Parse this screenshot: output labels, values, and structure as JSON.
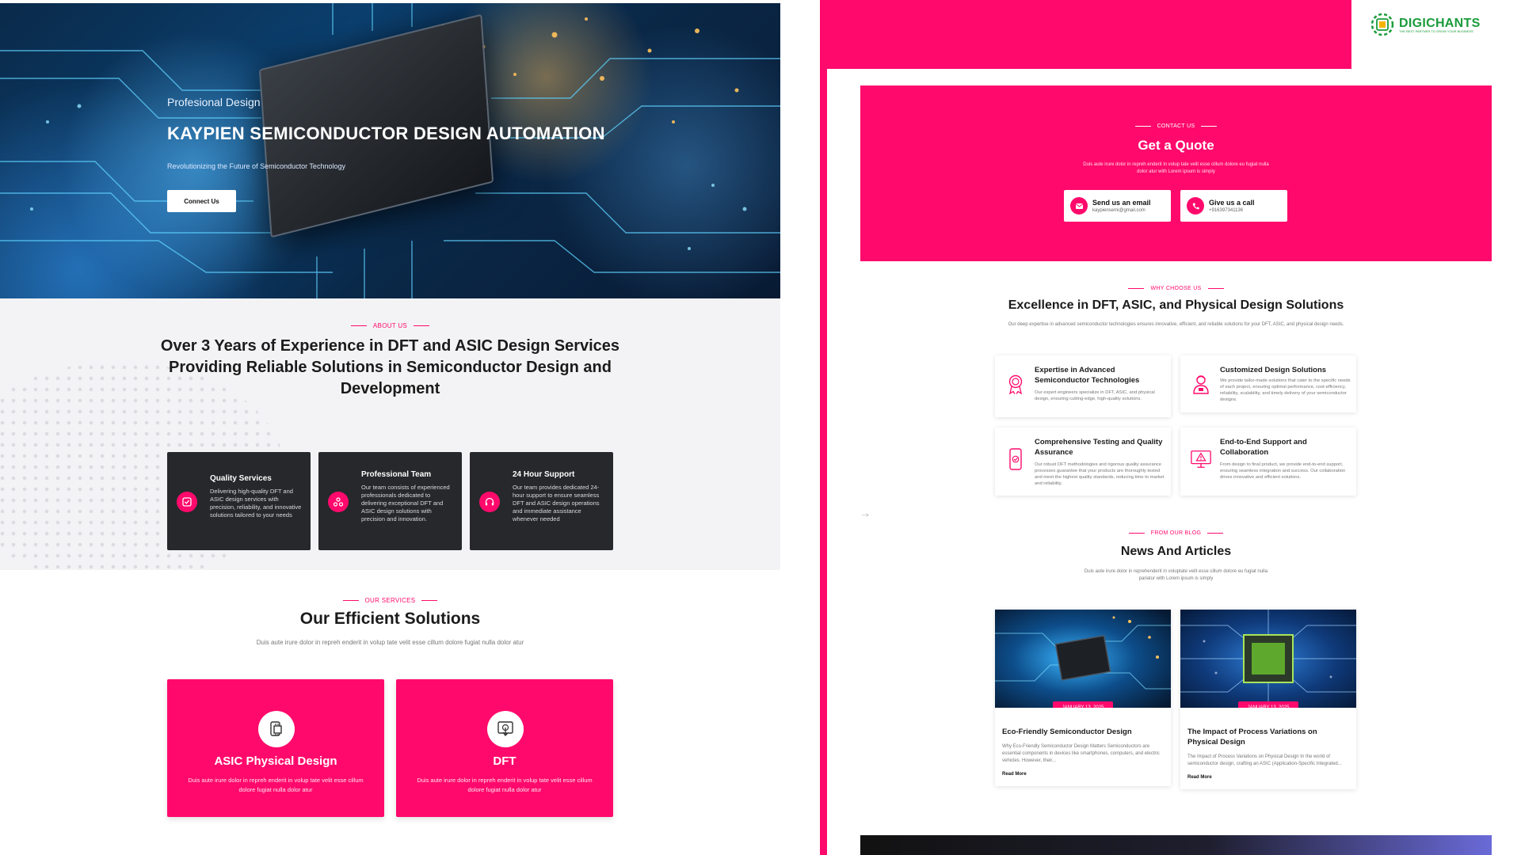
{
  "hero": {
    "pre": "Profesional Design",
    "title": "KAYPIEN SEMICONDUCTOR DESIGN AUTOMATION",
    "subtitle": "Revolutionizing the Future of Semiconductor Technology",
    "button": "Connect Us"
  },
  "about": {
    "tag": "ABOUT US",
    "heading_line1": "Over 3 Years of Experience in DFT and ASIC Design Services",
    "heading_line2": "Providing Reliable Solutions in Semiconductor Design and Development",
    "cards": [
      {
        "title": "Quality Services",
        "text": "Delivering high-quality DFT and ASIC design services with precision, reliability, and innovative solutions tailored to your needs",
        "icon": "quality-icon"
      },
      {
        "title": "Professional Team",
        "text": "Our team consists of experienced professionals dedicated to delivering exceptional DFT and ASIC design solutions with precision and innovation.",
        "icon": "team-icon"
      },
      {
        "title": "24 Hour Support",
        "text": "Our team provides dedicated 24-hour support to ensure seamless DFT and ASIC design operations and immediate assistance whenever needed",
        "icon": "headset-icon"
      }
    ]
  },
  "services": {
    "tag": "OUR SERVICES",
    "heading": "Our Efficient Solutions",
    "subtitle": "Duis aute irure dolor in repreh enderit in volup tate velit esse cillum dolore fugiat nulla dolor atur",
    "cards": [
      {
        "title": "ASIC Physical Design",
        "text": "Duis aute irure dolor in repreh enderit in volup tate velit esse cillum dolore fugiat nulla dolor atur",
        "icon": "chip-design-icon"
      },
      {
        "title": "DFT",
        "text": "Duis aute irure dolor in repreh enderit in volup tate velit esse cillum dolore fugiat nulla dolor atur",
        "icon": "touch-screen-icon"
      }
    ]
  },
  "brand": {
    "name": "DIGICHANTS",
    "tagline": "THE BEST PARTNER TO GROW YOUR BUSINESS",
    "color": "#1a9b3a"
  },
  "quote": {
    "tag": "CONTACT US",
    "heading": "Get a Quote",
    "subtitle": "Duis aute irure dolor in repreh enderit in volup tate velit esse cillum dolore eu fugiat nulla dolor atur with Lorem ipsum is simply",
    "email_label": "Send us an email",
    "email_value": "kaypiensemi@gmail.com",
    "call_label": "Give us a call",
    "call_value": "+916397341136"
  },
  "why": {
    "tag": "WHY CHOOSE US",
    "heading": "Excellence in DFT, ASIC, and Physical Design Solutions",
    "subtitle": "Our deep expertise in advanced semiconductor technologies ensures innovative, efficient, and reliable solutions for your DFT, ASIC, and physical design needs.",
    "features": [
      {
        "title": "Expertise in Advanced Semiconductor Technologies",
        "text": "Our expert engineers specialize in DFT, ASIC, and physical design, ensuring cutting-edge, high-quality solutions.",
        "icon": "award-icon"
      },
      {
        "title": "Customized Design Solutions",
        "text": "We provide tailor-made solutions that cater to the specific needs of each project, ensuring optimal performance, cost-efficiency, reliability, scalability, and timely delivery of your semiconductor designs.",
        "icon": "engineer-icon"
      },
      {
        "title": "Comprehensive Testing and Quality Assurance",
        "text": "Our robust DFT methodologies and rigorous quality assurance processes guarantee that your products are thoroughly tested and meet the highest quality standards, reducing time to market and reliability.",
        "icon": "mobile-check-icon"
      },
      {
        "title": "End-to-End Support and Collaboration",
        "text": "From design to final product, we provide end-to-end support, ensuring seamless integration and success. Our collaboration drives innovative and efficient solutions.",
        "icon": "monitor-alert-icon"
      }
    ]
  },
  "blog": {
    "tag": "FROM OUR BLOG",
    "heading": "News And Articles",
    "subtitle": "Duis aute irure dolor in reprehenderit in voluptate velit esse cillum dolore eu fugiat nulla pariatur with Lorem ipsum is simply",
    "posts": [
      {
        "date": "JANUARY 13, 2025",
        "title": "Eco-Friendly Semiconductor Design",
        "excerpt": "Why Eco-Friendly Semiconductor Design Matters Semiconductors are essential components in devices like smartphones, computers, and electric vehicles. However, their...",
        "read_more": "Read More"
      },
      {
        "date": "JANUARY 13, 2025",
        "title": "The Impact of Process Variations on Physical Design",
        "excerpt": "The Impact of Process Variations on Physical Design In the world of semiconductor design, crafting an ASIC (Application-Specific Integrated...",
        "read_more": "Read More"
      }
    ]
  },
  "misc": {
    "arrow": "-->"
  },
  "colors": {
    "accent": "#ff0a6c",
    "dark_card": "#26282b"
  }
}
